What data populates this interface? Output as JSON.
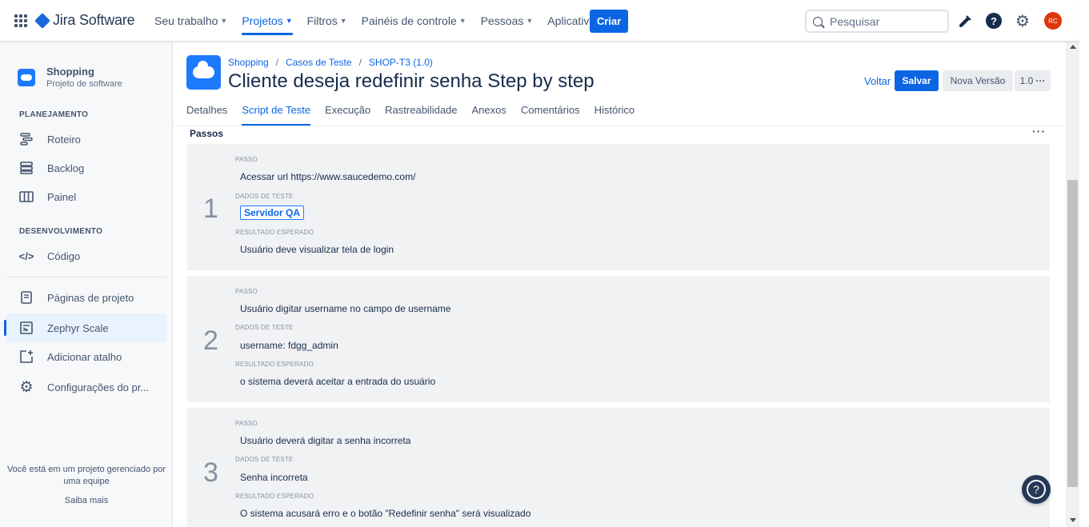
{
  "app": {
    "name": "Jira Software"
  },
  "topnav": {
    "items": [
      {
        "label": "Seu trabalho"
      },
      {
        "label": "Projetos"
      },
      {
        "label": "Filtros"
      },
      {
        "label": "Painéis de controle"
      },
      {
        "label": "Pessoas"
      },
      {
        "label": "Aplicativos"
      }
    ],
    "active_item": "Projetos",
    "create_label": "Criar",
    "search_placeholder": "Pesquisar",
    "avatar_initials": "RC",
    "brand_color": "#0c66e4",
    "avatar_color": "#de350b"
  },
  "sidebar": {
    "project_name": "Shopping",
    "project_type": "Projeto de software",
    "sections": [
      {
        "title": "PLANEJAMENTO",
        "items": [
          {
            "label": "Roteiro",
            "icon": "roadmap-icon"
          },
          {
            "label": "Backlog",
            "icon": "backlog-icon"
          },
          {
            "label": "Painel",
            "icon": "board-icon"
          }
        ]
      },
      {
        "title": "DESENVOLVIMENTO",
        "items": [
          {
            "label": "Código",
            "icon": "code-icon"
          }
        ]
      }
    ],
    "extra_items": [
      {
        "label": "Páginas de projeto",
        "icon": "page-icon"
      },
      {
        "label": "Zephyr Scale",
        "icon": "zephyr-icon",
        "active": true
      },
      {
        "label": "Adicionar atalho",
        "icon": "add-shortcut-icon"
      },
      {
        "label": "Configurações do pr...",
        "icon": "gear-icon"
      }
    ],
    "footer_text": "Você está em um projeto gerenciado por uma equipe",
    "footer_link": "Saiba mais"
  },
  "header": {
    "breadcrumb": [
      "Shopping",
      "Casos de Teste",
      "SHOP-T3 (1.0)"
    ],
    "title": "Cliente deseja redefinir senha Step by step",
    "back_label": "Voltar",
    "save_label": "Salvar",
    "new_version_label": "Nova Versão",
    "version_label": "1.0"
  },
  "tabs": [
    "Detalhes",
    "Script de Teste",
    "Execução",
    "Rastreabilidade",
    "Anexos",
    "Comentários",
    "Histórico"
  ],
  "active_tab": "Script de Teste",
  "steps_section": {
    "title": "Passos",
    "labels": {
      "step": "PASSO",
      "test_data": "DADOS DE TESTE",
      "expected": "RESULTADO ESPERADO"
    },
    "steps": [
      {
        "number": "1",
        "step": "Acessar url https://www.saucedemo.com/",
        "test_data": "Servidor QA",
        "test_data_is_tag": true,
        "expected": "Usuário deve visualizar tela de login"
      },
      {
        "number": "2",
        "step": "Usuário digitar username no campo de username",
        "test_data": "username: fdgg_admin",
        "test_data_is_tag": false,
        "expected": "o sistema deverá aceitar a entrada do usuário"
      },
      {
        "number": "3",
        "step": "Usuário deverá digitar a senha incorreta",
        "test_data": "Senha incorreta",
        "test_data_is_tag": false,
        "expected": "O sistema acusará erro e o botão \"Redefinir senha\" será visualizado"
      }
    ]
  },
  "help_fab": {
    "icon": "help-icon",
    "glyph": "?"
  }
}
